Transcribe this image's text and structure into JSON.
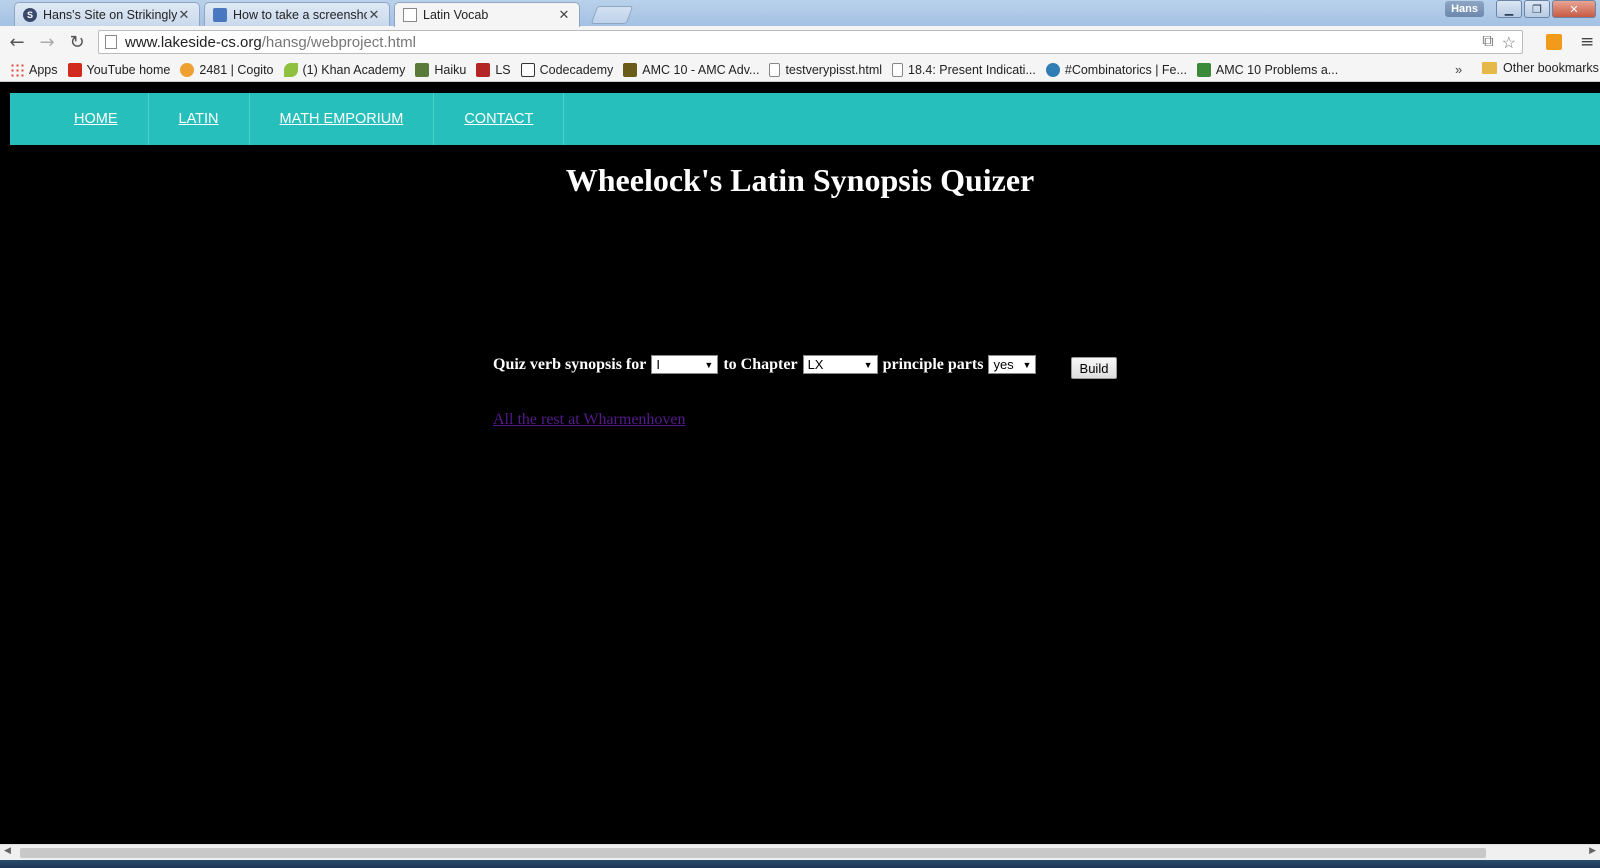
{
  "browser": {
    "tabs": [
      {
        "title": "Hans's Site on Strikingly",
        "favicon": "strikingly-icon"
      },
      {
        "title": "How to take a screenshot",
        "favicon": "screenshot-site-icon"
      },
      {
        "title": "Latin Vocab",
        "favicon": "page-icon",
        "active": true
      }
    ],
    "user_name": "Hans",
    "url_domain": "www.lakeside-cs.org",
    "url_path": "/hansg/webproject.html",
    "bookmarks": [
      {
        "label": "Apps",
        "icon": "apps-grid-icon"
      },
      {
        "label": "YouTube home",
        "icon": "youtube-icon"
      },
      {
        "label": "2481 | Cogito",
        "icon": "cogito-icon"
      },
      {
        "label": "(1) Khan Academy",
        "icon": "khan-academy-icon"
      },
      {
        "label": "Haiku",
        "icon": "haiku-icon"
      },
      {
        "label": "LS",
        "icon": "ls-icon"
      },
      {
        "label": "Codecademy",
        "icon": "codecademy-icon"
      },
      {
        "label": "AMC 10 - AMC Adv...",
        "icon": "amc-icon"
      },
      {
        "label": "testverypisst.html",
        "icon": "page-icon"
      },
      {
        "label": "18.4: Present Indicati...",
        "icon": "page-icon"
      },
      {
        "label": "#Combinatorics | Fe...",
        "icon": "combinatorics-icon"
      },
      {
        "label": "AMC 10 Problems a...",
        "icon": "amc-problems-icon"
      }
    ],
    "more_bookmarks": "»",
    "other_bookmarks": "Other bookmarks"
  },
  "site_nav": {
    "items": [
      "HOME",
      "LATIN",
      "MATH EMPORIUM",
      "CONTACT"
    ]
  },
  "page": {
    "title": "Wheelock's Latin Synopsis Quizer",
    "form": {
      "label_prefix": "Quiz verb synopsis for",
      "from_value": "I",
      "label_to": "to Chapter",
      "to_value": "LX",
      "label_parts": "principle parts",
      "parts_value": "yes",
      "build_label": "Build"
    },
    "rest_link": "All the rest at Wharmenhoven"
  },
  "colors": {
    "nav_background": "#26bfbb",
    "page_background": "#000000",
    "visited_link": "#551a8b"
  }
}
